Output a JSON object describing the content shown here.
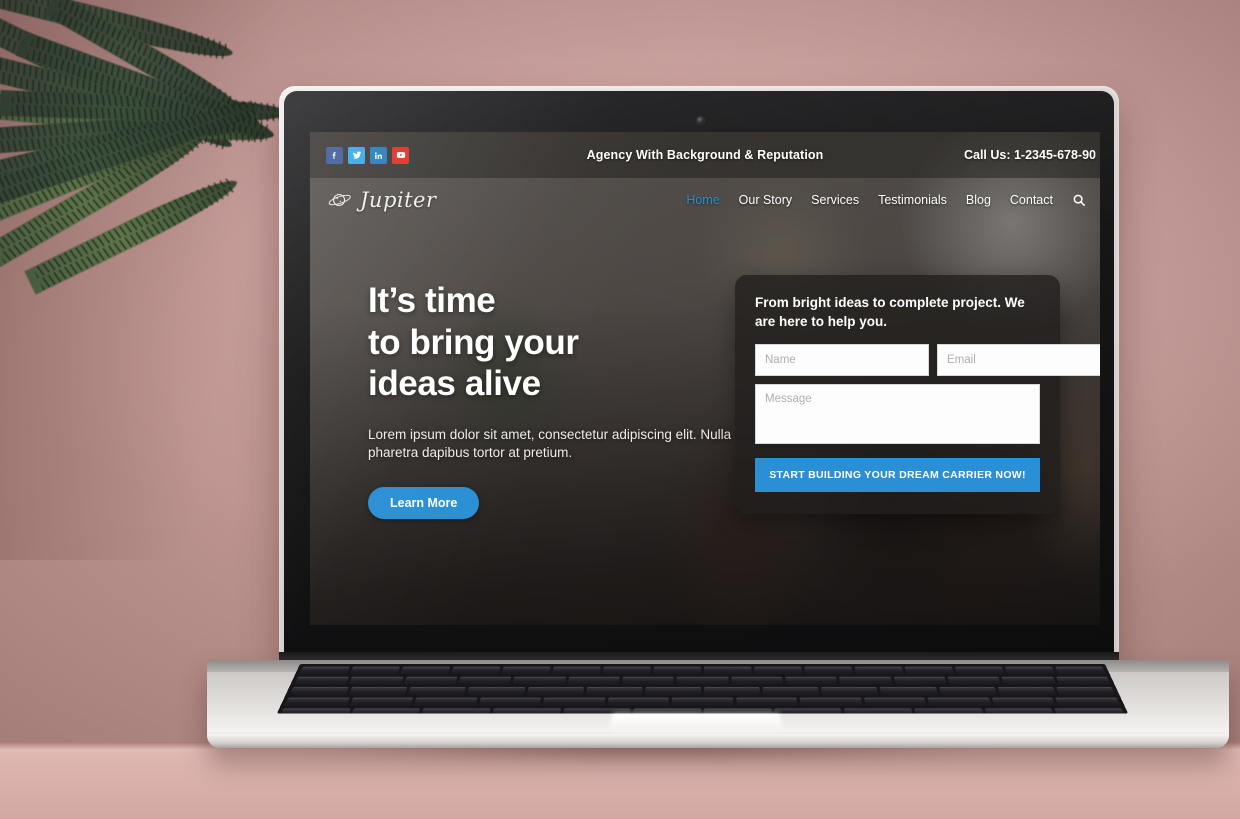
{
  "scene": {
    "description": "Laptop on a table showing an agency website landing page",
    "wall_color": "#c89f9c",
    "laptop_body_color": "#d9d6d3"
  },
  "site": {
    "topbar": {
      "tagline": "Agency With Background & Reputation",
      "phone": "Call Us: 1-2345-678-90",
      "social": [
        {
          "name": "facebook",
          "label": "f",
          "color": "#3b5998"
        },
        {
          "name": "twitter",
          "label": "t",
          "color": "#2fa8e8"
        },
        {
          "name": "linkedin",
          "label": "in",
          "color": "#1d7cb8"
        },
        {
          "name": "youtube",
          "label": "y",
          "color": "#e02b20"
        }
      ]
    },
    "brand": {
      "name": "Jupiter",
      "icon": "planet-icon"
    },
    "nav": {
      "items": [
        {
          "label": "Home",
          "active": true
        },
        {
          "label": "Our Story",
          "active": false
        },
        {
          "label": "Services",
          "active": false
        },
        {
          "label": "Testimonials",
          "active": false
        },
        {
          "label": "Blog",
          "active": false
        },
        {
          "label": "Contact",
          "active": false
        }
      ],
      "search_icon": "search-icon",
      "active_color": "#2a8fd4"
    },
    "hero": {
      "heading_line1": "It’s time",
      "heading_line2": "to bring your",
      "heading_line3": "ideas alive",
      "paragraph": "Lorem ipsum dolor sit amet, consectetur adipiscing elit. Nulla pharetra dapibus tortor at pretium.",
      "cta_label": "Learn More",
      "cta_color": "#2a8fd4"
    },
    "contact_card": {
      "title": "From bright ideas to complete project. We are here to help you.",
      "name_placeholder": "Name",
      "name_value": "",
      "email_placeholder": "Email",
      "email_value": "",
      "message_placeholder": "Message",
      "message_value": "",
      "submit_label": "START BUILDING YOUR DREAM CARRIER NOW!",
      "submit_color": "#2a8fd4"
    }
  }
}
